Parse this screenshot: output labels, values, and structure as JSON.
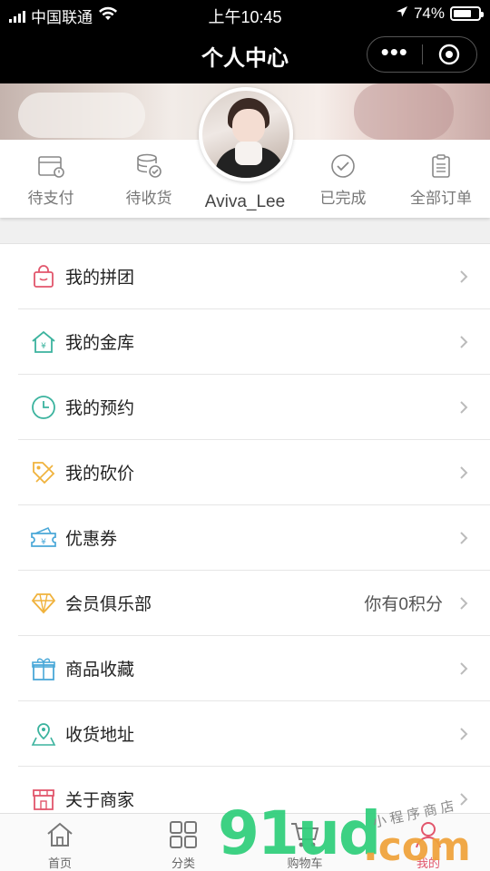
{
  "status_bar": {
    "carrier": "中国联通",
    "time": "上午10:45",
    "battery_text": "74%",
    "battery_level": 0.74
  },
  "nav": {
    "title": "个人中心",
    "more_icon": "more-dots-icon",
    "close_icon": "target-icon"
  },
  "profile": {
    "username": "Aviva_Lee"
  },
  "orders": [
    {
      "label": "待支付",
      "icon": "pending-payment-icon"
    },
    {
      "label": "待收货",
      "icon": "pending-receipt-icon"
    },
    {
      "label": "已完成",
      "icon": "completed-check-icon"
    },
    {
      "label": "全部订单",
      "icon": "all-orders-clipboard-icon"
    }
  ],
  "menu": [
    {
      "label": "我的拼团",
      "icon": "group-buy-bag-icon",
      "color": "#e2566c",
      "extra": ""
    },
    {
      "label": "我的金库",
      "icon": "vault-house-icon",
      "color": "#3bb39e",
      "extra": ""
    },
    {
      "label": "我的预约",
      "icon": "clock-icon",
      "color": "#3bb39e",
      "extra": ""
    },
    {
      "label": "我的砍价",
      "icon": "bargain-tag-icon",
      "color": "#f0b23c",
      "extra": ""
    },
    {
      "label": "优惠券",
      "icon": "coupon-icon",
      "color": "#4aa8d8",
      "extra": ""
    },
    {
      "label": "会员俱乐部",
      "icon": "diamond-icon",
      "color": "#f0b23c",
      "extra": "你有0积分"
    },
    {
      "label": "商品收藏",
      "icon": "gift-icon",
      "color": "#4aa8d8",
      "extra": ""
    },
    {
      "label": "收货地址",
      "icon": "map-pin-icon",
      "color": "#3bb39e",
      "extra": ""
    },
    {
      "label": "关于商家",
      "icon": "store-icon",
      "color": "#e2566c",
      "extra": ""
    }
  ],
  "tabs": [
    {
      "label": "首页",
      "icon": "home-icon",
      "active": false
    },
    {
      "label": "分类",
      "icon": "category-grid-icon",
      "active": false
    },
    {
      "label": "购物车",
      "icon": "cart-icon",
      "active": false
    },
    {
      "label": "我的",
      "icon": "user-icon",
      "active": true
    }
  ],
  "colors": {
    "accent": "#e2566c",
    "teal": "#3bb39e",
    "gold": "#f0b23c",
    "blue": "#4aa8d8"
  },
  "watermark": {
    "number": "91ud",
    "domain": ".com",
    "sub": "小程序商店"
  }
}
